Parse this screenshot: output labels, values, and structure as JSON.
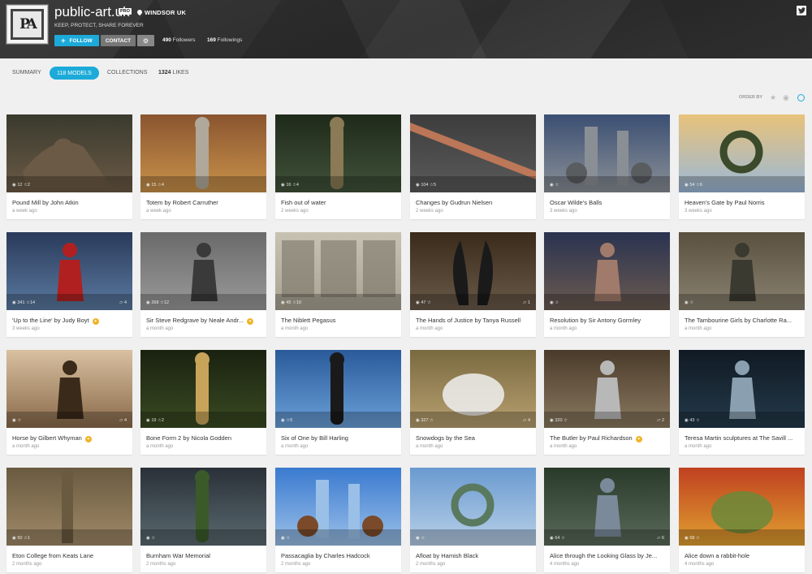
{
  "profile": {
    "username": "public-art.uk",
    "badge": "PRO",
    "location": "WINDSOR UK",
    "tagline": "KEEP, PROTECT, SHARE FOREVER",
    "avatar_text": "PA",
    "follow_label": "FOLLOW",
    "contact_label": "CONTACT",
    "followers_count": "490",
    "followers_label": "Followers",
    "followings_count": "169",
    "followings_label": "Followings"
  },
  "tabs": {
    "summary": "SUMMARY",
    "models": "118 MODELS",
    "collections": "COLLECTIONS",
    "likes_count": "1324",
    "likes_label": "LIKES"
  },
  "order_by": "ORDER BY",
  "colors": {
    "accent": "#1caad9",
    "staff_pick": "#f0b429",
    "header_bg": "#333333"
  },
  "models": [
    {
      "title": "Pound Mill by John Atkin",
      "date": "a week ago",
      "views": "12",
      "likes": "2",
      "comments": "",
      "staff": false,
      "palette": [
        "#3a3a2e",
        "#6b5a45",
        "#5e8a3a"
      ]
    },
    {
      "title": "Totem by Robert Carruther",
      "date": "a week ago",
      "views": "15",
      "likes": "4",
      "comments": "",
      "staff": false,
      "palette": [
        "#8a5530",
        "#c9924a",
        "#b0a89a"
      ]
    },
    {
      "title": "Fish out of water",
      "date": "2 weeks ago",
      "views": "16",
      "likes": "4",
      "comments": "",
      "staff": false,
      "palette": [
        "#1f2a1a",
        "#40523a",
        "#8a7a55"
      ]
    },
    {
      "title": "Changes by Gudrun Nielsen",
      "date": "2 weeks ago",
      "views": "104",
      "likes": "5",
      "comments": "",
      "staff": false,
      "palette": [
        "#3d3d3d",
        "#5a5a5a",
        "#c97b5a"
      ]
    },
    {
      "title": "Oscar Wilde's Balls",
      "date": "3 weeks ago",
      "views": "",
      "likes": "",
      "comments": "",
      "staff": false,
      "palette": [
        "#3b4f73",
        "#8a8f96",
        "#5a5d60"
      ]
    },
    {
      "title": "Heaven's Gate by Paul Norris",
      "date": "3 weeks ago",
      "views": "54",
      "likes": "6",
      "comments": "",
      "staff": false,
      "palette": [
        "#e8c27a",
        "#9ab8d8",
        "#3a4a2a"
      ]
    },
    {
      "title": "'Up to the Line' by Judy Boyt",
      "date": "3 weeks ago",
      "views": "341",
      "likes": "14",
      "comments": "4",
      "staff": true,
      "palette": [
        "#2a3a5a",
        "#5a7aa0",
        "#b02020"
      ]
    },
    {
      "title": "Sir Steve Redgrave by Neale Andr...",
      "date": "a month ago",
      "views": "268",
      "likes": "12",
      "comments": "",
      "staff": true,
      "palette": [
        "#6a6a6a",
        "#9a9a9a",
        "#3a3a3a"
      ]
    },
    {
      "title": "The Niblett Pegasus",
      "date": "a month ago",
      "views": "45",
      "likes": "10",
      "comments": "",
      "staff": false,
      "palette": [
        "#c8c2b2",
        "#a8a292",
        "#7a7468"
      ]
    },
    {
      "title": "The Hands of Justice by Tanya Russell",
      "date": "a month ago",
      "views": "47",
      "likes": "",
      "comments": "1",
      "staff": false,
      "palette": [
        "#3a2a1a",
        "#6a5a4a",
        "#1a1a1a"
      ]
    },
    {
      "title": "Resolution by Sir Antony Gormley",
      "date": "a month ago",
      "views": "",
      "likes": "",
      "comments": "",
      "staff": false,
      "palette": [
        "#2a3350",
        "#6a5a50",
        "#a07a6a"
      ]
    },
    {
      "title": "The Tambourine Girls by Charlotte Ra...",
      "date": "a month ago",
      "views": "",
      "likes": "",
      "comments": "",
      "staff": false,
      "palette": [
        "#5a5040",
        "#8a8270",
        "#3a3a30"
      ]
    },
    {
      "title": "Horse by Gilbert Whyman",
      "date": "a month ago",
      "views": "",
      "likes": "",
      "comments": "4",
      "staff": true,
      "palette": [
        "#d8c0a0",
        "#8a6a4a",
        "#3a2a1a"
      ]
    },
    {
      "title": "Bone Form 2 by Nicola Godden",
      "date": "a month ago",
      "views": "19",
      "likes": "2",
      "comments": "",
      "staff": false,
      "palette": [
        "#1a2210",
        "#3a4a22",
        "#c8a45a"
      ]
    },
    {
      "title": "Six of One by Bill Harling",
      "date": "a month ago",
      "views": "",
      "likes": "5",
      "comments": "",
      "staff": false,
      "palette": [
        "#2a5a9a",
        "#6aa0d8",
        "#1a1a1a"
      ]
    },
    {
      "title": "Snowdogs by the Sea",
      "date": "a month ago",
      "views": "327",
      "likes": "",
      "comments": "4",
      "staff": false,
      "palette": [
        "#7a6a40",
        "#b8a070",
        "#f0f0f0"
      ]
    },
    {
      "title": "The Butler by Paul Richardson",
      "date": "a month ago",
      "views": "320",
      "likes": "",
      "comments": "2",
      "staff": true,
      "palette": [
        "#4a3a2a",
        "#8a7a60",
        "#b8b8b8"
      ]
    },
    {
      "title": "Teresa Martin sculptures at The Savill ...",
      "date": "a month ago",
      "views": "43",
      "likes": "",
      "comments": "",
      "staff": false,
      "palette": [
        "#101a24",
        "#243a4a",
        "#8aa0b0"
      ]
    },
    {
      "title": "Eton College from Keats Lane",
      "date": "2 months ago",
      "views": "50",
      "likes": "1",
      "comments": "",
      "staff": false,
      "palette": [
        "#6a5a40",
        "#a08a68",
        "#3a3a3a"
      ]
    },
    {
      "title": "Burnham War Memorial",
      "date": "2 months ago",
      "views": "",
      "likes": "",
      "comments": "",
      "staff": false,
      "palette": [
        "#2a3038",
        "#5a6a70",
        "#3a5a2a"
      ]
    },
    {
      "title": "Passacaglia by Charles Hadcock",
      "date": "2 months ago",
      "views": "",
      "likes": "",
      "comments": "",
      "staff": false,
      "palette": [
        "#3a7ad0",
        "#9ac0e8",
        "#7a4a2a"
      ]
    },
    {
      "title": "Afloat by Hamish Black",
      "date": "2 months ago",
      "views": "",
      "likes": "",
      "comments": "",
      "staff": false,
      "palette": [
        "#6a9ad0",
        "#b8d0e8",
        "#5a7a60"
      ]
    },
    {
      "title": "Alice through the Looking Glass by Je...",
      "date": "4 months ago",
      "views": "64",
      "likes": "",
      "comments": "6",
      "staff": false,
      "palette": [
        "#2a3a2a",
        "#5a6a5a",
        "#7a8a9a"
      ]
    },
    {
      "title": "Alice down a rabbit-hole",
      "date": "4 months ago",
      "views": "58",
      "likes": "",
      "comments": "",
      "staff": false,
      "palette": [
        "#c04020",
        "#e0a030",
        "#6a8a3a"
      ]
    }
  ]
}
